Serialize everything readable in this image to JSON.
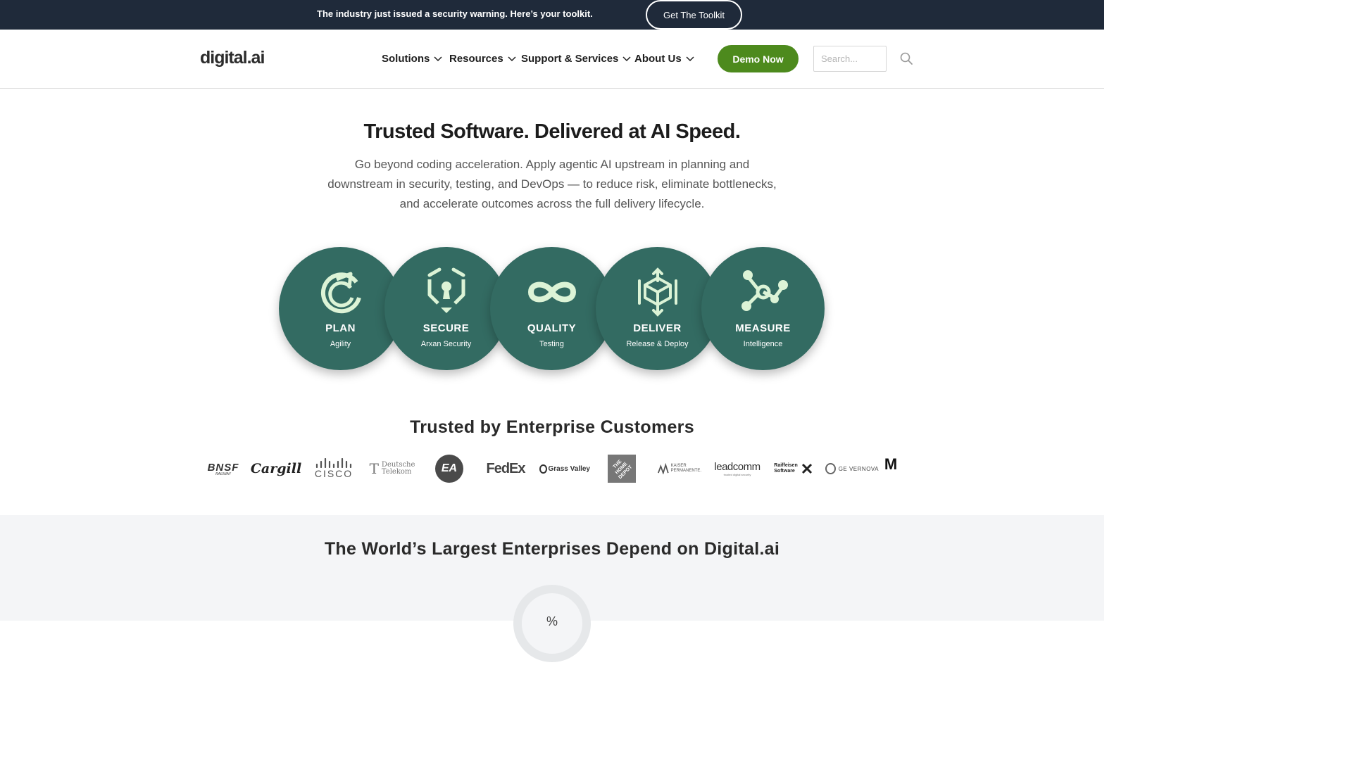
{
  "banner": {
    "text": "The industry just issued a security warning. Here’s your toolkit.",
    "button_label": "Get The Toolkit",
    "bg_color": "#1f2a3a"
  },
  "header": {
    "logo": "digital.ai",
    "nav": [
      {
        "label": "Solutions"
      },
      {
        "label": "Resources"
      },
      {
        "label": "Support & Services"
      },
      {
        "label": "About Us"
      }
    ],
    "demo_label": "Demo Now",
    "demo_color": "#4d8a1d",
    "search_placeholder": "Search...",
    "search_icon": "search-icon"
  },
  "hero": {
    "title": "Trusted Software. Delivered at AI Speed.",
    "subtitle": "Go beyond coding acceleration. Apply agentic AI upstream in planning and downstream in security, testing, and DevOps — to reduce risk, eliminate bottlenecks, and accelerate outcomes across the full delivery lifecycle."
  },
  "pillars": {
    "color": "#336b62",
    "icon_color": "#dcf3d6",
    "items": [
      {
        "title": "PLAN",
        "subtitle": "Agility",
        "icon": "plan-icon"
      },
      {
        "title": "SECURE",
        "subtitle": "Arxan Security",
        "icon": "shield-lock-icon"
      },
      {
        "title": "QUALITY",
        "subtitle": "Testing",
        "icon": "infinity-icon"
      },
      {
        "title": "DELIVER",
        "subtitle": "Release & Deploy",
        "icon": "cube-arrows-icon"
      },
      {
        "title": "MEASURE",
        "subtitle": "Intelligence",
        "icon": "network-nodes-icon"
      }
    ]
  },
  "customers": {
    "title": "Trusted by Enterprise Customers",
    "logos": [
      {
        "name": "BNSF",
        "text": "BNSF",
        "sub": "RAILWAY"
      },
      {
        "name": "Cargill",
        "text": "Cargill"
      },
      {
        "name": "Cisco",
        "text": "CISCO"
      },
      {
        "name": "Deutsche Telekom",
        "text": "Deutsche",
        "sub": "Telekom"
      },
      {
        "name": "EA",
        "text": "EA"
      },
      {
        "name": "FedEx",
        "text": "FedEx"
      },
      {
        "name": "Grass Valley",
        "text": "Grass Valley"
      },
      {
        "name": "The Home Depot",
        "text": "THE HOME DEPOT"
      },
      {
        "name": "Kaiser Permanente",
        "text": "KAISER",
        "sub": "PERMANENTE."
      },
      {
        "name": "leadcomm",
        "text": "leadcomm",
        "sub": "trusted digital security"
      },
      {
        "name": "Raiffeisen Software",
        "text": "Raiffeisen",
        "sub": "Software"
      },
      {
        "name": "GE Vernova",
        "text": "GE VERNOVA"
      },
      {
        "name": "M",
        "text": "M"
      }
    ]
  },
  "enterprise": {
    "title": "The World’s Largest Enterprises Depend on Digital.ai",
    "stat_symbol": "%"
  }
}
